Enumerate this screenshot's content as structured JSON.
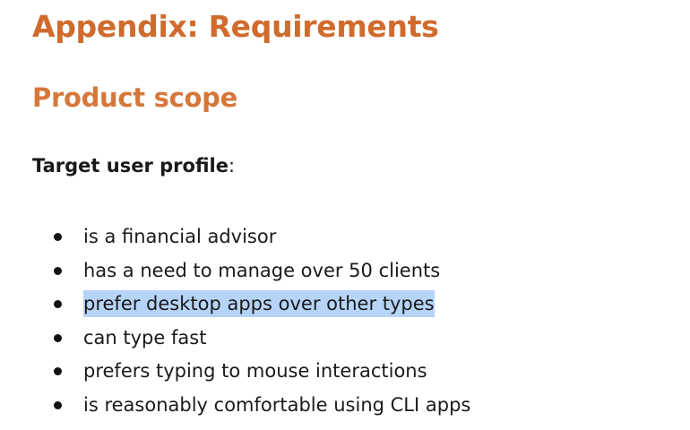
{
  "document": {
    "heading": "Appendix: Requirements",
    "subheading": "Product scope",
    "profile_label": "Target user profile",
    "profile_suffix": ":",
    "items": [
      {
        "text": "is a financial advisor",
        "selected": false
      },
      {
        "text": "has a need to manage over 50 clients",
        "selected": false
      },
      {
        "text": "prefer desktop apps over other types",
        "selected": true
      },
      {
        "text": "can type fast",
        "selected": false
      },
      {
        "text": "prefers typing to mouse interactions",
        "selected": false
      },
      {
        "text": "is reasonably comfortable using CLI apps",
        "selected": false
      }
    ],
    "colors": {
      "heading": "#d06b2c",
      "subheading": "#d6773a",
      "selection": "#b6d4f7",
      "text": "#1a1a1a"
    }
  }
}
